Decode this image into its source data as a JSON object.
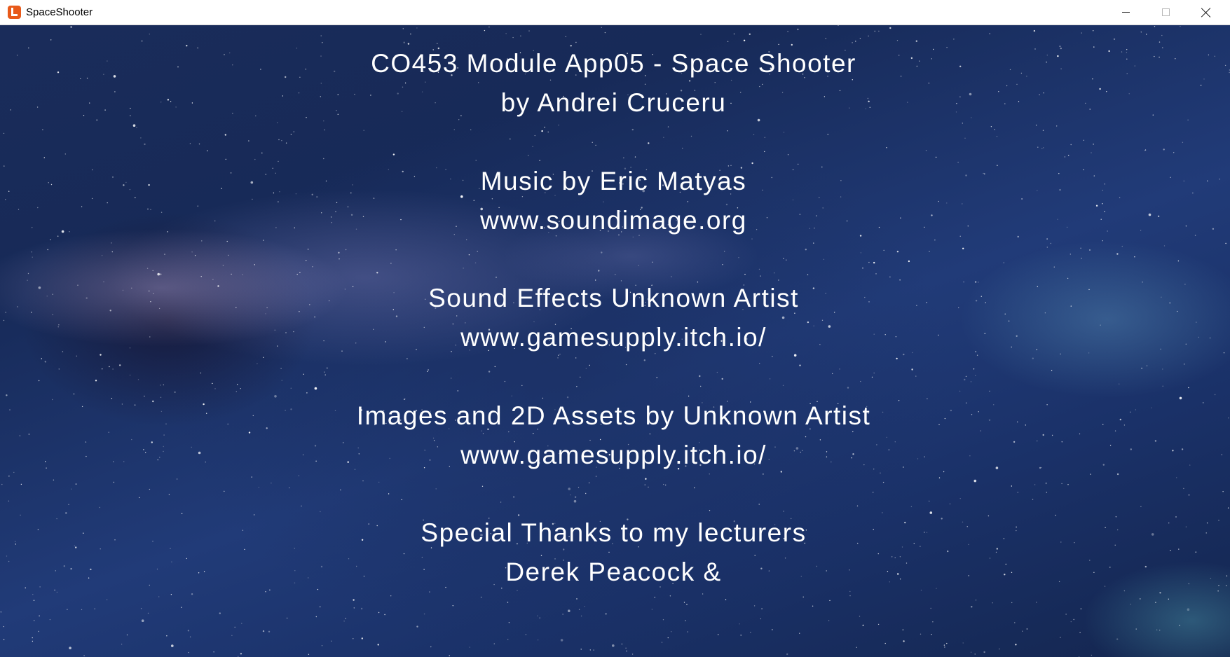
{
  "window": {
    "title": "SpaceShooter"
  },
  "credits": {
    "lines": [
      "CO453 Module App05 - Space Shooter",
      "by Andrei Cruceru",
      "Music by Eric Matyas",
      "www.soundimage.org",
      "Sound Effects Unknown Artist",
      "www.gamesupply.itch.io/",
      "Images and 2D Assets by Unknown Artist",
      "www.gamesupply.itch.io/",
      "Special Thanks to my lecturers",
      "Derek Peacock &"
    ]
  },
  "colors": {
    "text": "#ffffff",
    "icon_accent": "#e85a1a"
  }
}
